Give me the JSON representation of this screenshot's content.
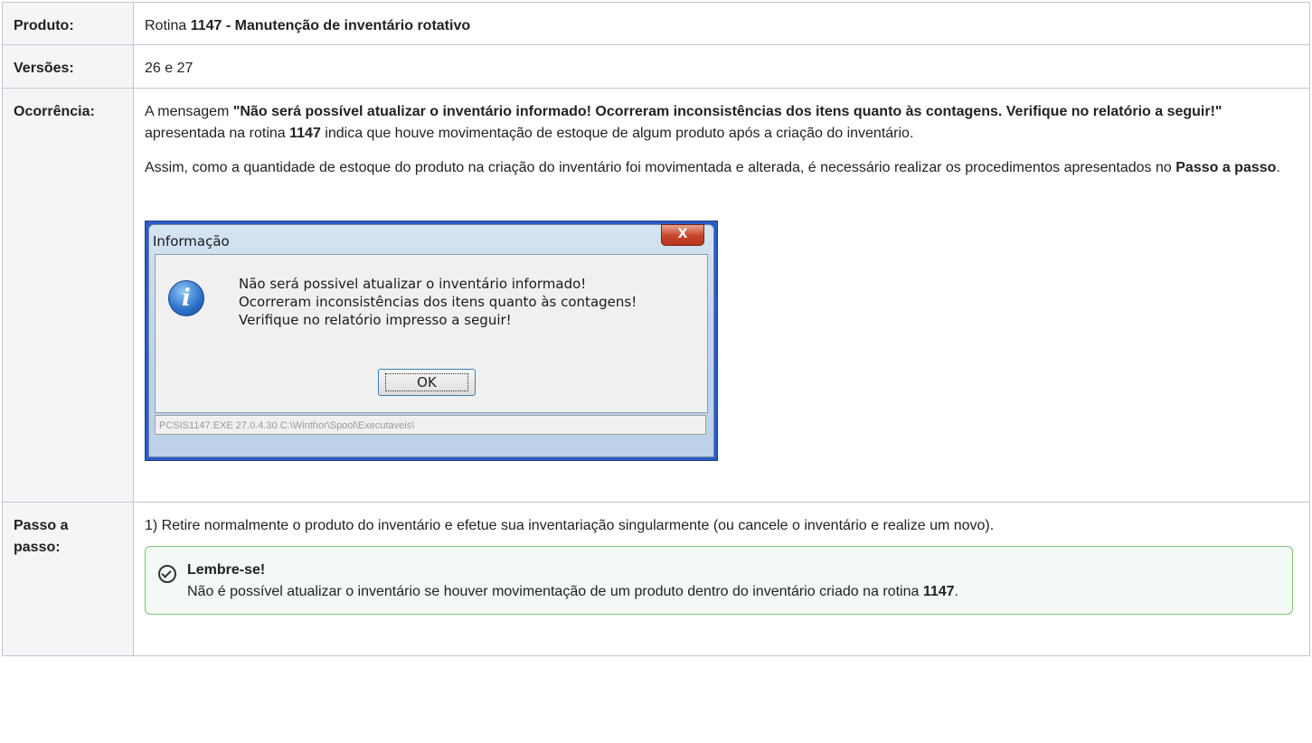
{
  "rows": {
    "produto": {
      "label": "Produto:",
      "prefix": "Rotina ",
      "bold": "1147 - Manutenção de inventário rotativo"
    },
    "versoes": {
      "label": "Versões:",
      "value": "26 e 27"
    },
    "ocorrencia": {
      "label": "Ocorrência:",
      "p1_a": "A mensagem ",
      "p1_b": "\"Não será possível atualizar o inventário informado! Ocorreram inconsistências dos itens quanto às contagens. Verifique no relatório a seguir!\"",
      "p1_c": " apresentada na rotina ",
      "p1_d": "1147",
      "p1_e": " indica que houve movimentação de estoque de algum produto após a criação do inventário.",
      "p2_a": "Assim, como a quantidade de estoque do produto na criação do inventário foi movimentada e alterada, é necessário realizar os procedimentos apresentados no ",
      "p2_b": "Passo a passo",
      "p2_c": "."
    },
    "passo": {
      "label_line1": "Passo a",
      "label_line2": "passo:",
      "step1": "1) Retire normalmente o produto do inventário e efetue sua inventariação singularmente (ou cancele o inventário e realize um novo).",
      "tip_title": "Lembre-se!",
      "tip_text_a": "Não é possível atualizar o inventário se houver movimentação de um produto dentro do inventário criado na rotina ",
      "tip_text_b": "1147",
      "tip_text_c": "."
    }
  },
  "dialog": {
    "title": "Informação",
    "close": "X",
    "line1": "Não será possivel atualizar o inventário informado!",
    "line2": "Ocorreram inconsistências dos itens quanto às contagens!",
    "line3": "Verifique no relatório impresso a seguir!",
    "ok": "OK",
    "status": "PCSIS1147.EXE 27.0.4.30 C:\\Winthor\\Spool\\Executaveis\\",
    "icon": "info-icon"
  },
  "colors": {
    "border": "#c1c7d0",
    "label_bg": "#f4f5f7",
    "tip_border": "#7fbf7f",
    "tip_bg": "#f3f9f4"
  }
}
